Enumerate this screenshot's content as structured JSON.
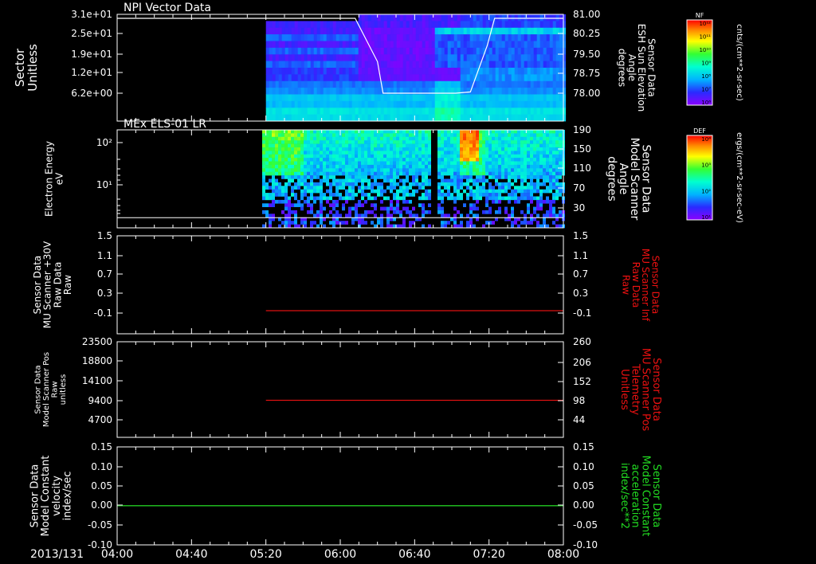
{
  "page": {
    "date_label": "2013/131",
    "time_ticks": [
      "04:00",
      "04:40",
      "05:20",
      "06:00",
      "06:40",
      "07:20",
      "08:00"
    ]
  },
  "chart_data": [
    {
      "type": "heatmap",
      "title": "NPI Vector Data",
      "ylabel": [
        "Sector",
        "Unitless"
      ],
      "yticks": [
        "3.1e+01",
        "2.5e+01",
        "1.9e+01",
        "1.2e+01",
        "6.2e+00"
      ],
      "y2label": [
        "Sensor Data",
        "ESH Sun Elevation",
        "Angle",
        "degrees"
      ],
      "y2ticks": [
        "81.00",
        "80.25",
        "79.50",
        "78.75",
        "78.00"
      ],
      "xlim": [
        "04:00",
        "08:00"
      ],
      "data_start": "05:20",
      "colorbar": {
        "label": "NF",
        "unit": "cnts/(cm**2-sr-sec)",
        "ticks": [
          "10¹²",
          "10¹¹",
          "10¹⁰",
          "10⁹",
          "10⁸",
          "10⁷",
          "10⁶"
        ]
      },
      "overlay_line": {
        "color": "#ffffff",
        "x": [
          "04:00",
          "06:08",
          "06:20",
          "06:23",
          "07:02",
          "07:10",
          "07:19",
          "07:23",
          "08:00"
        ],
        "y": [
          80.85,
          80.85,
          79.2,
          78.0,
          78.0,
          78.05,
          79.8,
          80.85,
          80.85
        ]
      }
    },
    {
      "type": "heatmap",
      "title": "MEx ELS-01 LR",
      "ylabel": [
        "Electron Energy",
        "eV"
      ],
      "yticks": [
        "10²",
        "10¹"
      ],
      "y2label": [
        "Sensor Data",
        "Model Scanner",
        "Angle",
        "degrees"
      ],
      "y2ticks": [
        "190",
        "150",
        "110",
        "70",
        "30"
      ],
      "xlim": [
        "04:00",
        "08:00"
      ],
      "data_start": "05:18",
      "colorbar": {
        "label": "DEF",
        "unit": "ergs/(cm**2-sr-sec-eV)",
        "ticks": [
          "10⁴",
          "10³",
          "10²",
          "10¹"
        ]
      },
      "overlay_line": {
        "color": "#ffffff",
        "x": [
          "04:00",
          "08:00"
        ],
        "y": [
          10,
          10
        ]
      }
    },
    {
      "type": "line",
      "ylabel": [
        "Sensor Data",
        "MU Scanner +30V",
        "Raw Data",
        "Raw"
      ],
      "yticks": [
        "1.5",
        "1.1",
        "0.7",
        "0.3",
        "-0.1"
      ],
      "y2label": [
        "Sensor Data",
        "MU Scanner Inf",
        "Raw Data",
        "Raw"
      ],
      "y2ticks": [
        "1.5",
        "1.1",
        "0.7",
        "0.3",
        "-0.1"
      ],
      "ylim": [
        -0.5,
        1.5
      ],
      "series": [
        {
          "color": "#dd1111",
          "x": [
            "05:20",
            "08:00"
          ],
          "y": [
            -0.05,
            -0.05
          ]
        }
      ]
    },
    {
      "type": "line",
      "ylabel": [
        "Sensor Data",
        "Model Scanner Pos",
        "Raw",
        "unitless"
      ],
      "yticks": [
        "23500",
        "18800",
        "14100",
        "9400",
        "4700"
      ],
      "y2label": [
        "Sensor Data",
        "MU Scanner Pos",
        "Telemetry",
        "Unitless"
      ],
      "y2ticks": [
        "260",
        "206",
        "152",
        "98",
        "44"
      ],
      "ylim": [
        0,
        23500
      ],
      "series": [
        {
          "color": "#dd1111",
          "x": [
            "05:20",
            "08:00"
          ],
          "y": [
            98,
            98
          ]
        }
      ]
    },
    {
      "type": "line",
      "ylabel": [
        "Sensor Data",
        "Model Constant",
        "velocity",
        "index/sec"
      ],
      "yticks": [
        "0.15",
        "0.10",
        "0.05",
        "0.00",
        "-0.05",
        "-0.10"
      ],
      "y2label": [
        "Sensor Data",
        "Model Constant",
        "acceleration",
        "index/sec**2"
      ],
      "y2ticks": [
        "0.15",
        "0.10",
        "0.05",
        "0.00",
        "-0.05",
        "-0.10"
      ],
      "ylim": [
        -0.1,
        0.15
      ],
      "series": [
        {
          "color": "#22cc22",
          "x": [
            "04:00",
            "08:00"
          ],
          "y": [
            0.0,
            0.0
          ]
        }
      ]
    }
  ]
}
